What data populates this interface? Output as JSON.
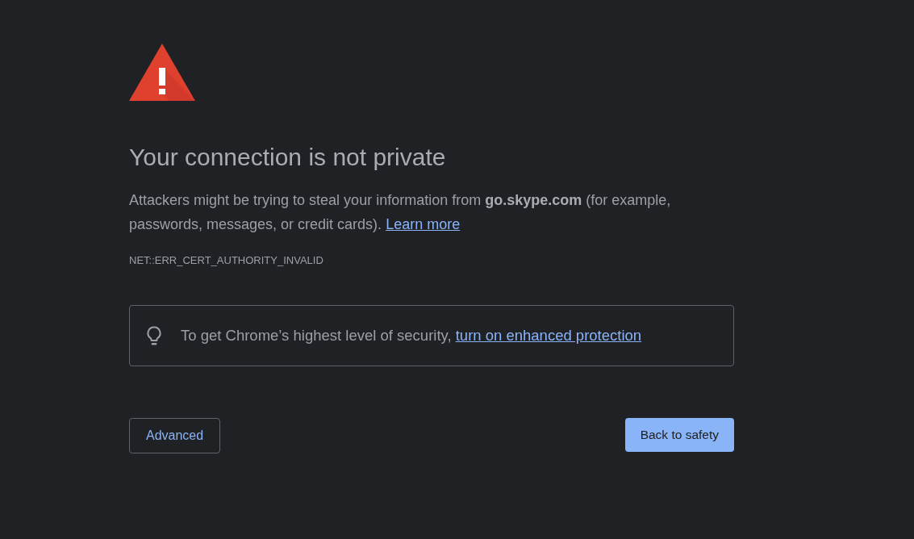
{
  "heading": "Your connection is not private",
  "message": "Attackers might be trying to steal your information from **go.skype.com** (for example, passwords, messages, or credit cards).",
  "message_link": "Learn more",
  "error_code": "NET::ERR_CERT_AUTHORITY_INVALID",
  "enhanced_protection": {
    "text": "To get Chrome’s highest level of security,",
    "link": "turn on enhanced protection"
  },
  "buttons": [
    {
      "label": "Advanced",
      "kind": "secondary"
    },
    {
      "label": "Back to safety",
      "kind": "primary"
    }
  ]
}
